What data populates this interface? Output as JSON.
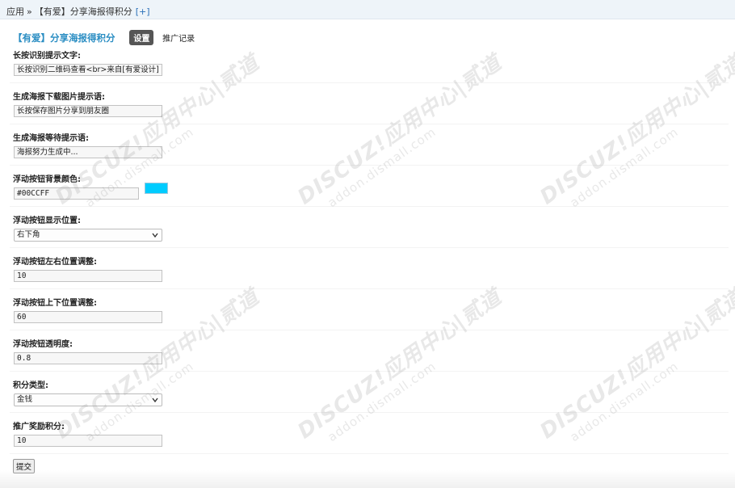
{
  "breadcrumb": {
    "root": "应用",
    "separator": "»",
    "current": "【有爱】分享海报得积分",
    "add": "[+]"
  },
  "header": {
    "title": "【有爱】分享海报得积分",
    "tab_settings": "设置",
    "tab_records": "推广记录"
  },
  "fields": [
    {
      "label": "长按识别提示文字:",
      "value": "长按识别二维码查看<br>来自[有爱设计]"
    },
    {
      "label": "生成海报下载图片提示语:",
      "value": "长按保存图片分享到朋友圈"
    },
    {
      "label": "生成海报等待提示语:",
      "value": "海报努力生成中..."
    },
    {
      "label": "浮动按钮背景颜色:",
      "value": "#00CCFF",
      "swatch_color": "#00ccff"
    },
    {
      "label": "浮动按钮显示位置:",
      "value": "右下角"
    },
    {
      "label": "浮动按钮左右位置调整:",
      "value": "10"
    },
    {
      "label": "浮动按钮上下位置调整:",
      "value": "60"
    },
    {
      "label": "浮动按钮透明度:",
      "value": "0.8"
    },
    {
      "label": "积分类型:",
      "value": "金钱"
    },
    {
      "label": "推广奖励积分:",
      "value": "10"
    }
  ],
  "submit_label": "提交",
  "watermark": {
    "brand": "DISCUZ!应用中心|贰道",
    "domain": "addon.dismall.com"
  }
}
